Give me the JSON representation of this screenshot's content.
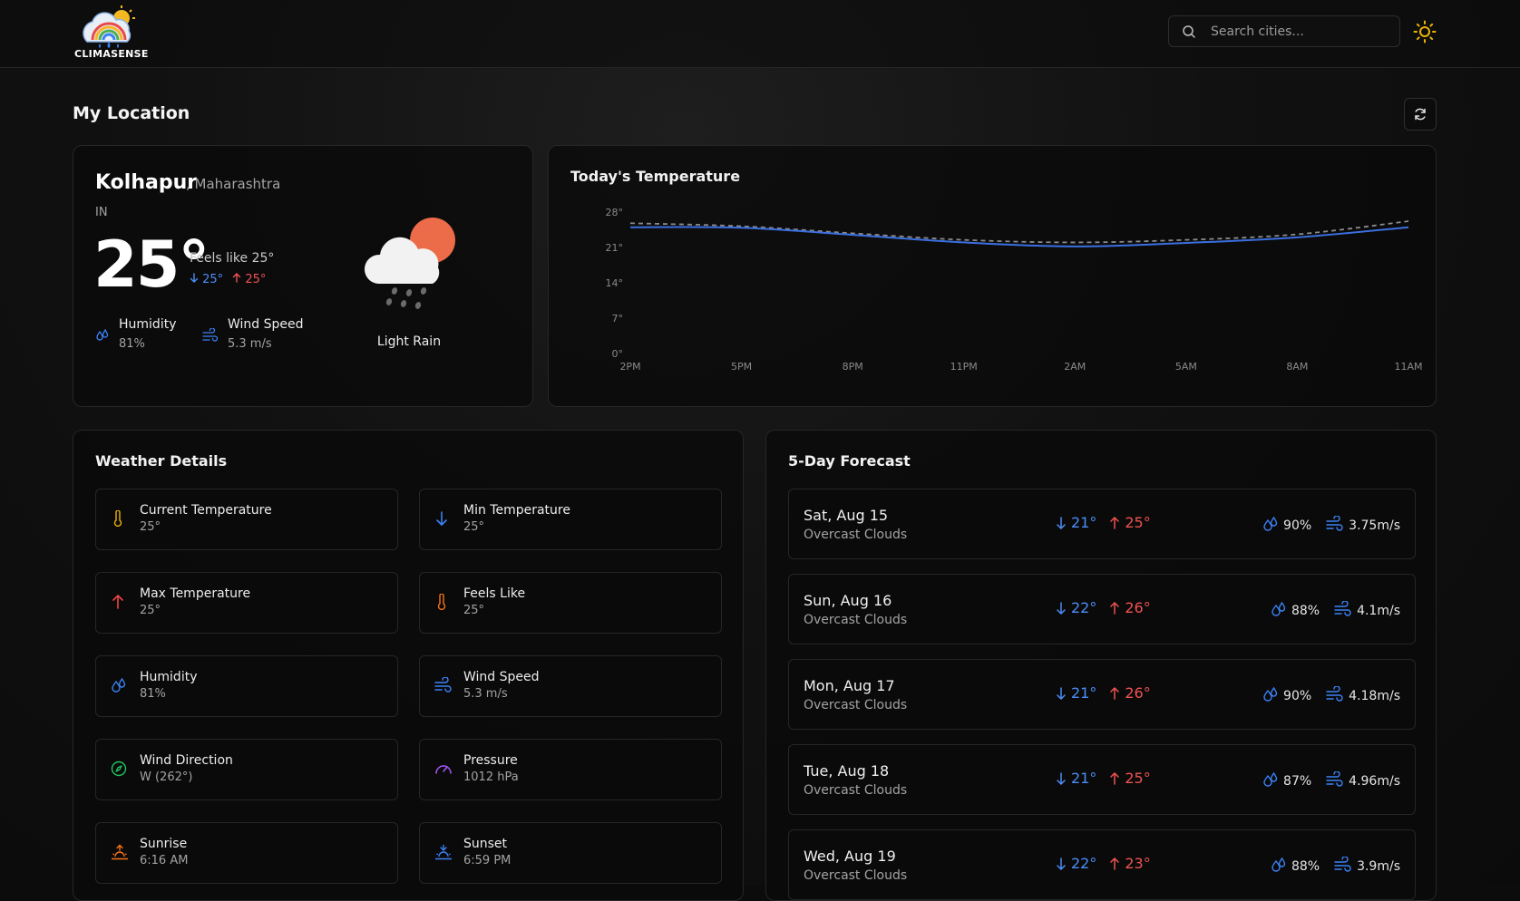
{
  "header": {
    "logo_text": "CLIMASENSE",
    "search_placeholder": "Search cities..."
  },
  "page": {
    "title": "My Location"
  },
  "current": {
    "city": "Kolhapur",
    "region": ", Maharashtra",
    "country": "IN",
    "temp": "25°",
    "feels_like": "Feels like 25°",
    "min": "25°",
    "max": "25°",
    "humidity_label": "Humidity",
    "humidity_value": "81%",
    "wind_label": "Wind Speed",
    "wind_value": "5.3 m/s",
    "description": "Light Rain"
  },
  "chart": {
    "title": "Today's Temperature",
    "y_ticks": [
      "28°",
      "21°",
      "14°",
      "7°",
      "0°"
    ],
    "x_ticks": [
      "2PM",
      "5PM",
      "8PM",
      "11PM",
      "2AM",
      "5AM",
      "8AM",
      "11AM"
    ]
  },
  "chart_data": {
    "type": "line",
    "title": "Today's Temperature",
    "x": [
      "2PM",
      "5PM",
      "8PM",
      "11PM",
      "2AM",
      "5AM",
      "8AM",
      "11AM"
    ],
    "ylim": [
      0,
      28
    ],
    "y_ticks": [
      0,
      7,
      14,
      21,
      28
    ],
    "series": [
      {
        "values": [
          25.0,
          24.9,
          23.5,
          22.0,
          21.2,
          21.9,
          23.0,
          25.0
        ],
        "style": "solid",
        "color": "#3b6fe0"
      },
      {
        "values": [
          25.8,
          25.2,
          23.8,
          22.5,
          22.0,
          22.5,
          23.6,
          26.2
        ],
        "style": "dashed",
        "color": "#8a8a8a"
      }
    ],
    "grid": false,
    "legend": false
  },
  "details": {
    "title": "Weather Details",
    "items": [
      {
        "label": "Current Temperature",
        "value": "25°",
        "icon": "thermometer-icon",
        "color": "#eab308"
      },
      {
        "label": "Min Temperature",
        "value": "25°",
        "icon": "arrow-down-icon",
        "color": "#3b82f6"
      },
      {
        "label": "Max Temperature",
        "value": "25°",
        "icon": "arrow-up-icon",
        "color": "#ef4444"
      },
      {
        "label": "Feels Like",
        "value": "25°",
        "icon": "thermometer-icon",
        "color": "#f97316"
      },
      {
        "label": "Humidity",
        "value": "81%",
        "icon": "droplets-icon",
        "color": "#3b82f6"
      },
      {
        "label": "Wind Speed",
        "value": "5.3 m/s",
        "icon": "wind-icon",
        "color": "#3b82f6"
      },
      {
        "label": "Wind Direction",
        "value": "W (262°)",
        "icon": "compass-icon",
        "color": "#22c55e"
      },
      {
        "label": "Pressure",
        "value": "1012 hPa",
        "icon": "gauge-icon",
        "color": "#a855f7"
      },
      {
        "label": "Sunrise",
        "value": "6:16 AM",
        "icon": "sunrise-icon",
        "color": "#f97316"
      },
      {
        "label": "Sunset",
        "value": "6:59 PM",
        "icon": "sunset-icon",
        "color": "#3b82f6"
      }
    ]
  },
  "forecast": {
    "title": "5-Day Forecast",
    "days": [
      {
        "day": "Sat, Aug 15",
        "desc": "Overcast Clouds",
        "min": "21°",
        "max": "25°",
        "humidity": "90%",
        "wind": "3.75m/s"
      },
      {
        "day": "Sun, Aug 16",
        "desc": "Overcast Clouds",
        "min": "22°",
        "max": "26°",
        "humidity": "88%",
        "wind": "4.1m/s"
      },
      {
        "day": "Mon, Aug 17",
        "desc": "Overcast Clouds",
        "min": "21°",
        "max": "26°",
        "humidity": "90%",
        "wind": "4.18m/s"
      },
      {
        "day": "Tue, Aug 18",
        "desc": "Overcast Clouds",
        "min": "21°",
        "max": "25°",
        "humidity": "87%",
        "wind": "4.96m/s"
      },
      {
        "day": "Wed, Aug 19",
        "desc": "Overcast Clouds",
        "min": "22°",
        "max": "23°",
        "humidity": "88%",
        "wind": "3.9m/s"
      }
    ]
  },
  "colors": {
    "accent_blue": "#3b82f6",
    "accent_red": "#ef4444",
    "sun_yellow": "#eab308"
  }
}
